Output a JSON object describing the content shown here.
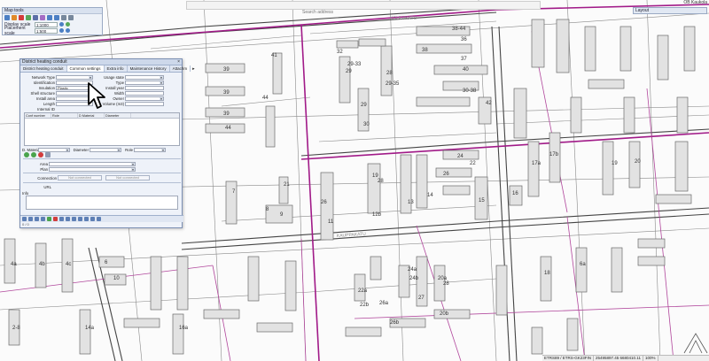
{
  "toolbar": {
    "title": "Map tools",
    "display_scale_label": "Display scale",
    "display_scale_value": "1:1000",
    "placement_scale_label": "Placement scale",
    "placement_scale_value": "1:500"
  },
  "search": {
    "placeholder": "Search address"
  },
  "layout_panel": {
    "title": "Layout"
  },
  "user": {
    "name": "OB Kaukola"
  },
  "dialog": {
    "title": "District heating conduit",
    "tabs": [
      {
        "label": "District heating conduit"
      },
      {
        "label": "Common settings"
      },
      {
        "label": "Extra info"
      },
      {
        "label": "Maintenance History"
      },
      {
        "label": "Attachm"
      }
    ],
    "fields_left": [
      {
        "label": "Network Type",
        "value": ""
      },
      {
        "label": "Identification",
        "value": ""
      },
      {
        "label": "Insulation",
        "value": "Plastic"
      },
      {
        "label": "Shell structure",
        "value": ""
      },
      {
        "label": "Install area",
        "value": ""
      },
      {
        "label": "Length",
        "value": ""
      },
      {
        "label": "Internal ID",
        "value": ""
      }
    ],
    "fields_right": [
      {
        "label": "Usage state",
        "value": ""
      },
      {
        "label": "Type",
        "value": ""
      },
      {
        "label": "Install year",
        "value": ""
      },
      {
        "label": "Width",
        "value": ""
      },
      {
        "label": "Owner",
        "value": ""
      },
      {
        "label": "Volume (m3)",
        "value": ""
      }
    ],
    "grid_columns": [
      "Conf number",
      "Role",
      "D Material",
      "Diameter"
    ],
    "grid_filters": {
      "material_label": "D. Material",
      "diameter_label": "Diameter",
      "role_label": "Role"
    },
    "area_label": "Area",
    "plan_label": "Plan",
    "connection_label": "Connection",
    "not_connected_1": "Not connected",
    "not_connected_2": "Not connected",
    "url_label": "URL",
    "info_label": "Info",
    "status": "0 / 0"
  },
  "statusbar": {
    "crs": "ETRS89 / ETRS-GK23FIN",
    "coords": "25495897.45 6680410.11",
    "zoom": "100%"
  },
  "map_labels": [
    "39",
    "39",
    "39",
    "41",
    "44",
    "44",
    "29",
    "29",
    "28",
    "30",
    "32",
    "29-33",
    "36",
    "37",
    "38-44",
    "40",
    "42",
    "38",
    "30-38",
    "29-35",
    "19",
    "22",
    "24",
    "26",
    "28",
    "17a",
    "17b",
    "26",
    "21",
    "11",
    "12b",
    "13",
    "14",
    "15",
    "16",
    "19",
    "20",
    "7",
    "8",
    "9",
    "6",
    "10",
    "4a",
    "4b",
    "4c",
    "26a",
    "26b",
    "27",
    "28",
    "20a",
    "20b",
    "22a",
    "22b",
    "24a",
    "24b",
    "18",
    "6a",
    "2-8",
    "14a",
    "16a"
  ]
}
